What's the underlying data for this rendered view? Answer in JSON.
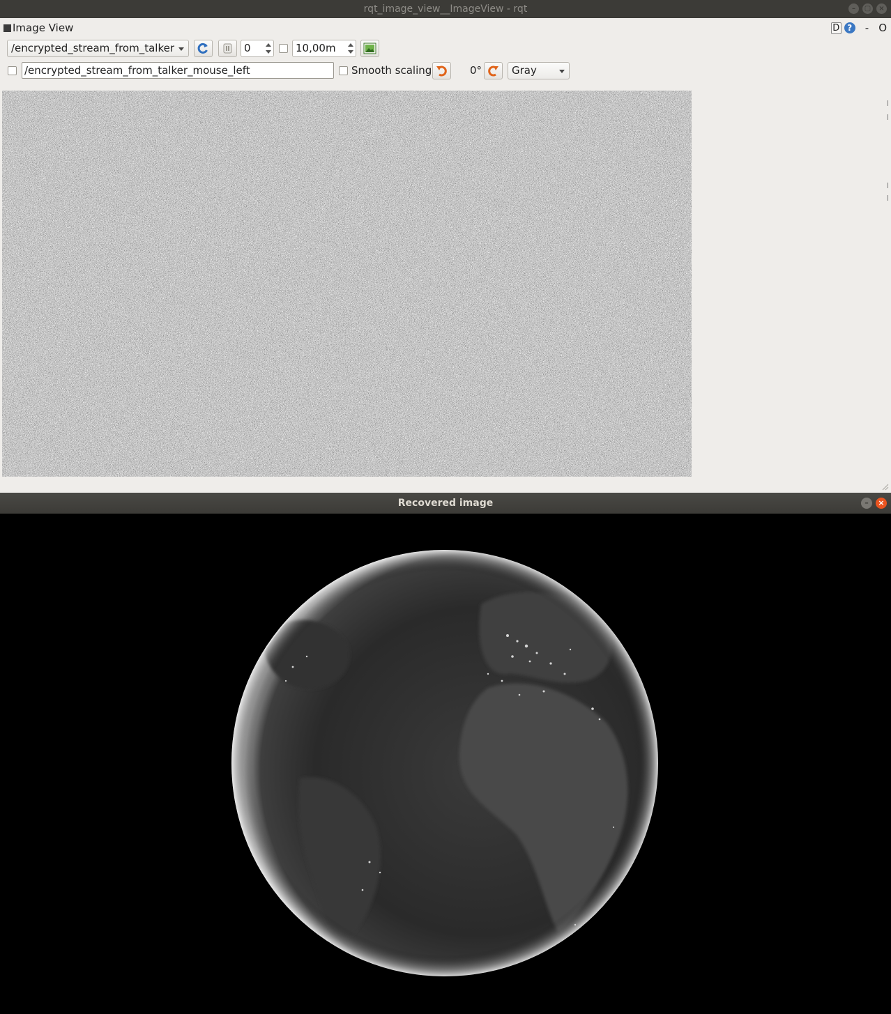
{
  "window": {
    "title": "rqt_image_view__ImageView - rqt",
    "controls": [
      "–",
      "▢",
      "×"
    ]
  },
  "plugin": {
    "title": "Image View",
    "d_label": "D",
    "help_label": "?",
    "minimize_label": "-",
    "close_label": "O"
  },
  "toolbar": {
    "topic": "/encrypted_stream_from_talker",
    "frame_value": "0",
    "timeout_value": "10,00m",
    "mouse_topic": "/encrypted_stream_from_talker_mouse_left",
    "smooth_scaling_label": "Smooth scaling",
    "rotation_label": "0°",
    "color_scheme": "Gray",
    "icons": {
      "refresh": "refresh-icon",
      "pause": "pause-icon",
      "save": "save-image-icon",
      "rotate_left": "rotate-left-icon",
      "rotate_right": "rotate-right-icon"
    }
  },
  "recovered": {
    "title": "Recovered image",
    "minimize_label": "–",
    "close_label": "×"
  },
  "colors": {
    "rqt_background": "#efedea",
    "titlebar": "#3c3b37",
    "close_accent": "#e95420",
    "refresh_blue": "#3b78c3",
    "rotate_orange": "#e0641a"
  }
}
